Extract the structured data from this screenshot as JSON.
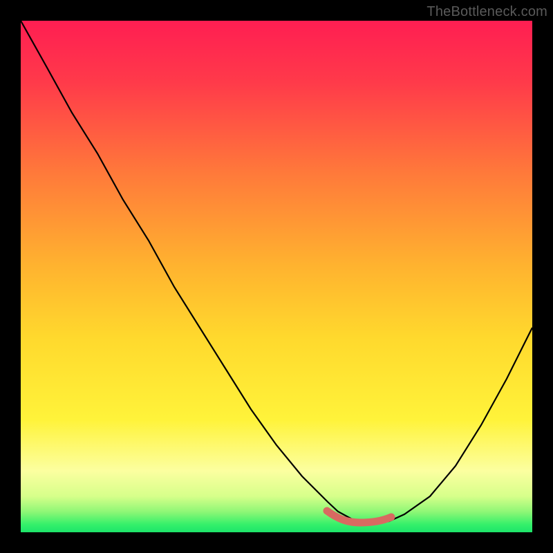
{
  "watermark": "TheBottleneck.com",
  "colors": {
    "gradient_top": "#ff1e52",
    "gradient_mid": "#ffcf2e",
    "gradient_low": "#fdffaa",
    "gradient_green": "#34f06a",
    "curve": "#000000",
    "trough_marker": "#d86a61",
    "background": "#000000"
  },
  "chart_data": {
    "type": "line",
    "title": "",
    "xlabel": "",
    "ylabel": "",
    "xlim": [
      0,
      100
    ],
    "ylim": [
      0,
      100
    ],
    "series": [
      {
        "name": "bottleneck-curve",
        "x": [
          0,
          5,
          10,
          15,
          20,
          25,
          30,
          35,
          40,
          45,
          50,
          55,
          60,
          62,
          65,
          68,
          70,
          72,
          75,
          80,
          85,
          90,
          95,
          100
        ],
        "y": [
          100,
          91,
          82,
          74,
          65,
          57,
          48,
          40,
          32,
          24,
          17,
          11,
          6,
          4,
          2.5,
          2,
          2,
          2.2,
          3.5,
          7,
          13,
          21,
          30,
          40
        ]
      },
      {
        "name": "trough-marker",
        "x": [
          60,
          63,
          66,
          69,
          72
        ],
        "y": [
          3.5,
          2.5,
          2,
          2.2,
          2.8
        ]
      }
    ],
    "annotations": []
  }
}
